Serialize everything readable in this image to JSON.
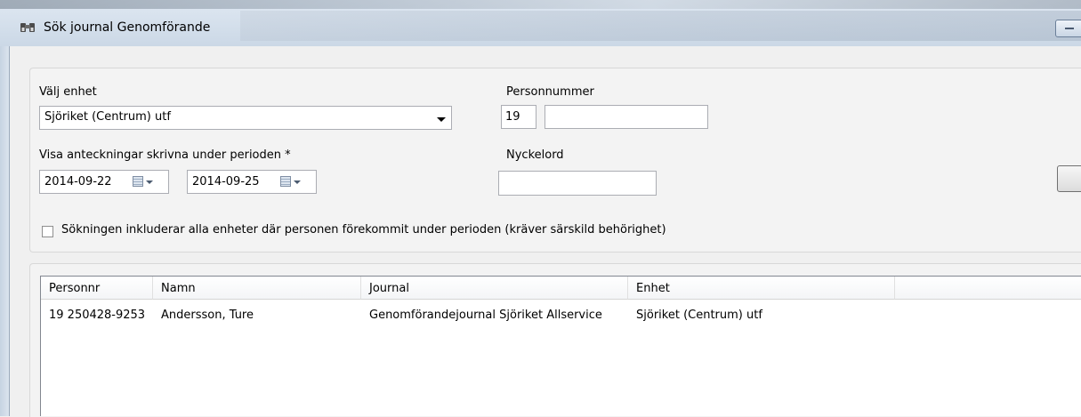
{
  "window": {
    "title": "Sök journal Genomförande"
  },
  "form": {
    "unit_label": "Välj enhet",
    "unit_value": "Sjöriket (Centrum) utf",
    "personnummer_label": "Personnummer",
    "personnummer_prefix": "19",
    "personnummer_value": "",
    "period_label": "Visa anteckningar skrivna under perioden *",
    "date_from": "2014-09-22",
    "date_to": "2014-09-25",
    "keyword_label": "Nyckelord",
    "keyword_value": "",
    "include_all_label": "Sökningen inkluderar alla enheter där personen förekommit under perioden (kräver särskild behörighet)",
    "include_all_checked": false
  },
  "results": {
    "columns": [
      "Personnr",
      "Namn",
      "Journal",
      "Enhet"
    ],
    "rows": [
      {
        "personnr": "19 250428-9253",
        "namn": "Andersson, Ture",
        "journal": "Genomförandejournal Sjöriket Allservice",
        "enhet": "Sjöriket (Centrum) utf"
      }
    ]
  },
  "colors": {
    "title_bar": "#d6e1ee",
    "window_bg": "#f0f0f0",
    "input_border": "#abadb3"
  },
  "icons": {
    "window_icon": "binoculars-icon",
    "calendar": "calendar-icon"
  }
}
